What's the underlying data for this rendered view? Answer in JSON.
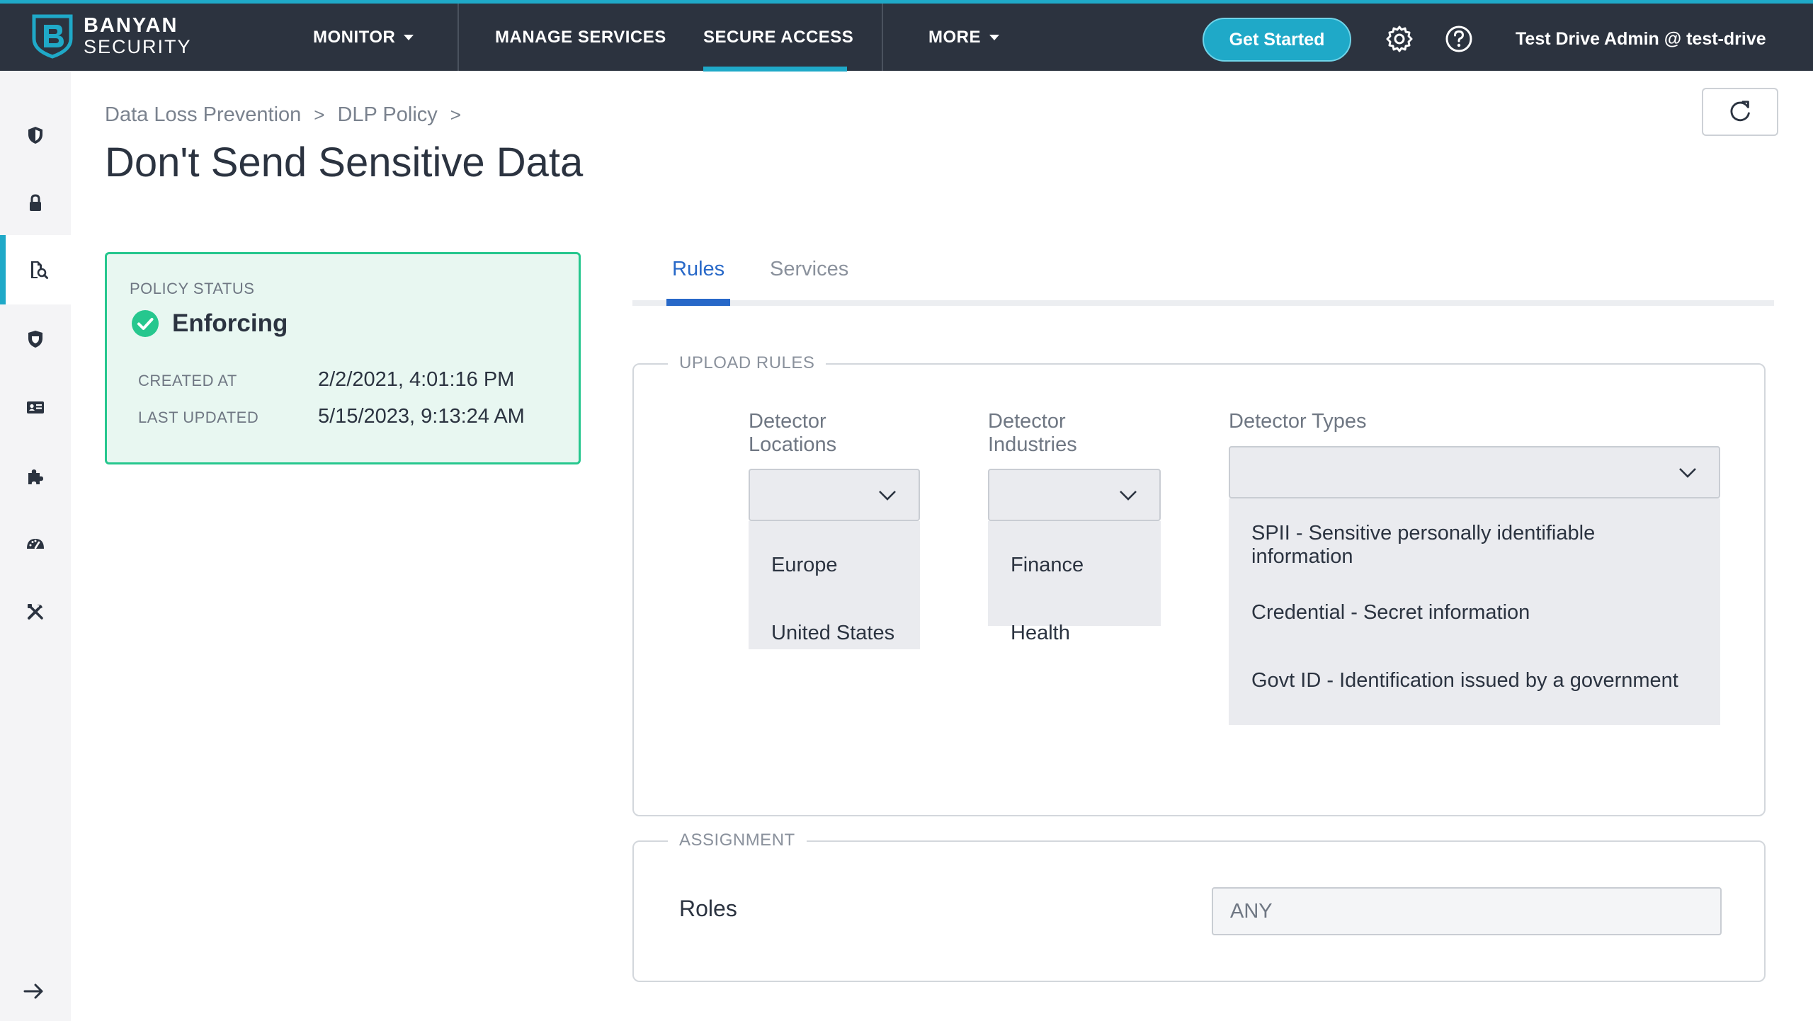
{
  "brand": {
    "line1": "BANYAN",
    "line2": "SECURITY"
  },
  "nav": {
    "monitor": "MONITOR",
    "manage_services": "MANAGE SERVICES",
    "secure_access": "SECURE ACCESS",
    "more": "MORE",
    "get_started": "Get Started",
    "user": "Test Drive Admin @ test-drive"
  },
  "breadcrumb": {
    "level1": "Data Loss Prevention",
    "level2": "DLP Policy",
    "separator": ">"
  },
  "page": {
    "title": "Don't Send Sensitive Data"
  },
  "policy_status": {
    "label": "POLICY STATUS",
    "value": "Enforcing",
    "created_label": "CREATED AT",
    "created_value": "2/2/2021, 4:01:16 PM",
    "updated_label": "LAST UPDATED",
    "updated_value": "5/15/2023, 9:13:24 AM",
    "accent": "#26c78e"
  },
  "tabs": {
    "rules": "Rules",
    "services": "Services"
  },
  "upload_rules": {
    "legend": "UPLOAD RULES",
    "locations": {
      "label_line1": "Detector",
      "label_line2": "Locations",
      "options": [
        "Europe",
        "United States"
      ]
    },
    "industries": {
      "label_line1": "Detector",
      "label_line2": "Industries",
      "options": [
        "Finance",
        "Health"
      ]
    },
    "types": {
      "label": "Detector Types",
      "options": [
        "SPII - Sensitive personally identifiable information",
        "Credential - Secret information",
        "Govt ID - Identification issued by a government"
      ]
    }
  },
  "assignment": {
    "legend": "ASSIGNMENT",
    "roles_label": "Roles",
    "roles_value": "ANY"
  },
  "colors": {
    "nav_bg": "#2c333f",
    "accent": "#1fa9c8",
    "tab_active": "#2768c8"
  }
}
